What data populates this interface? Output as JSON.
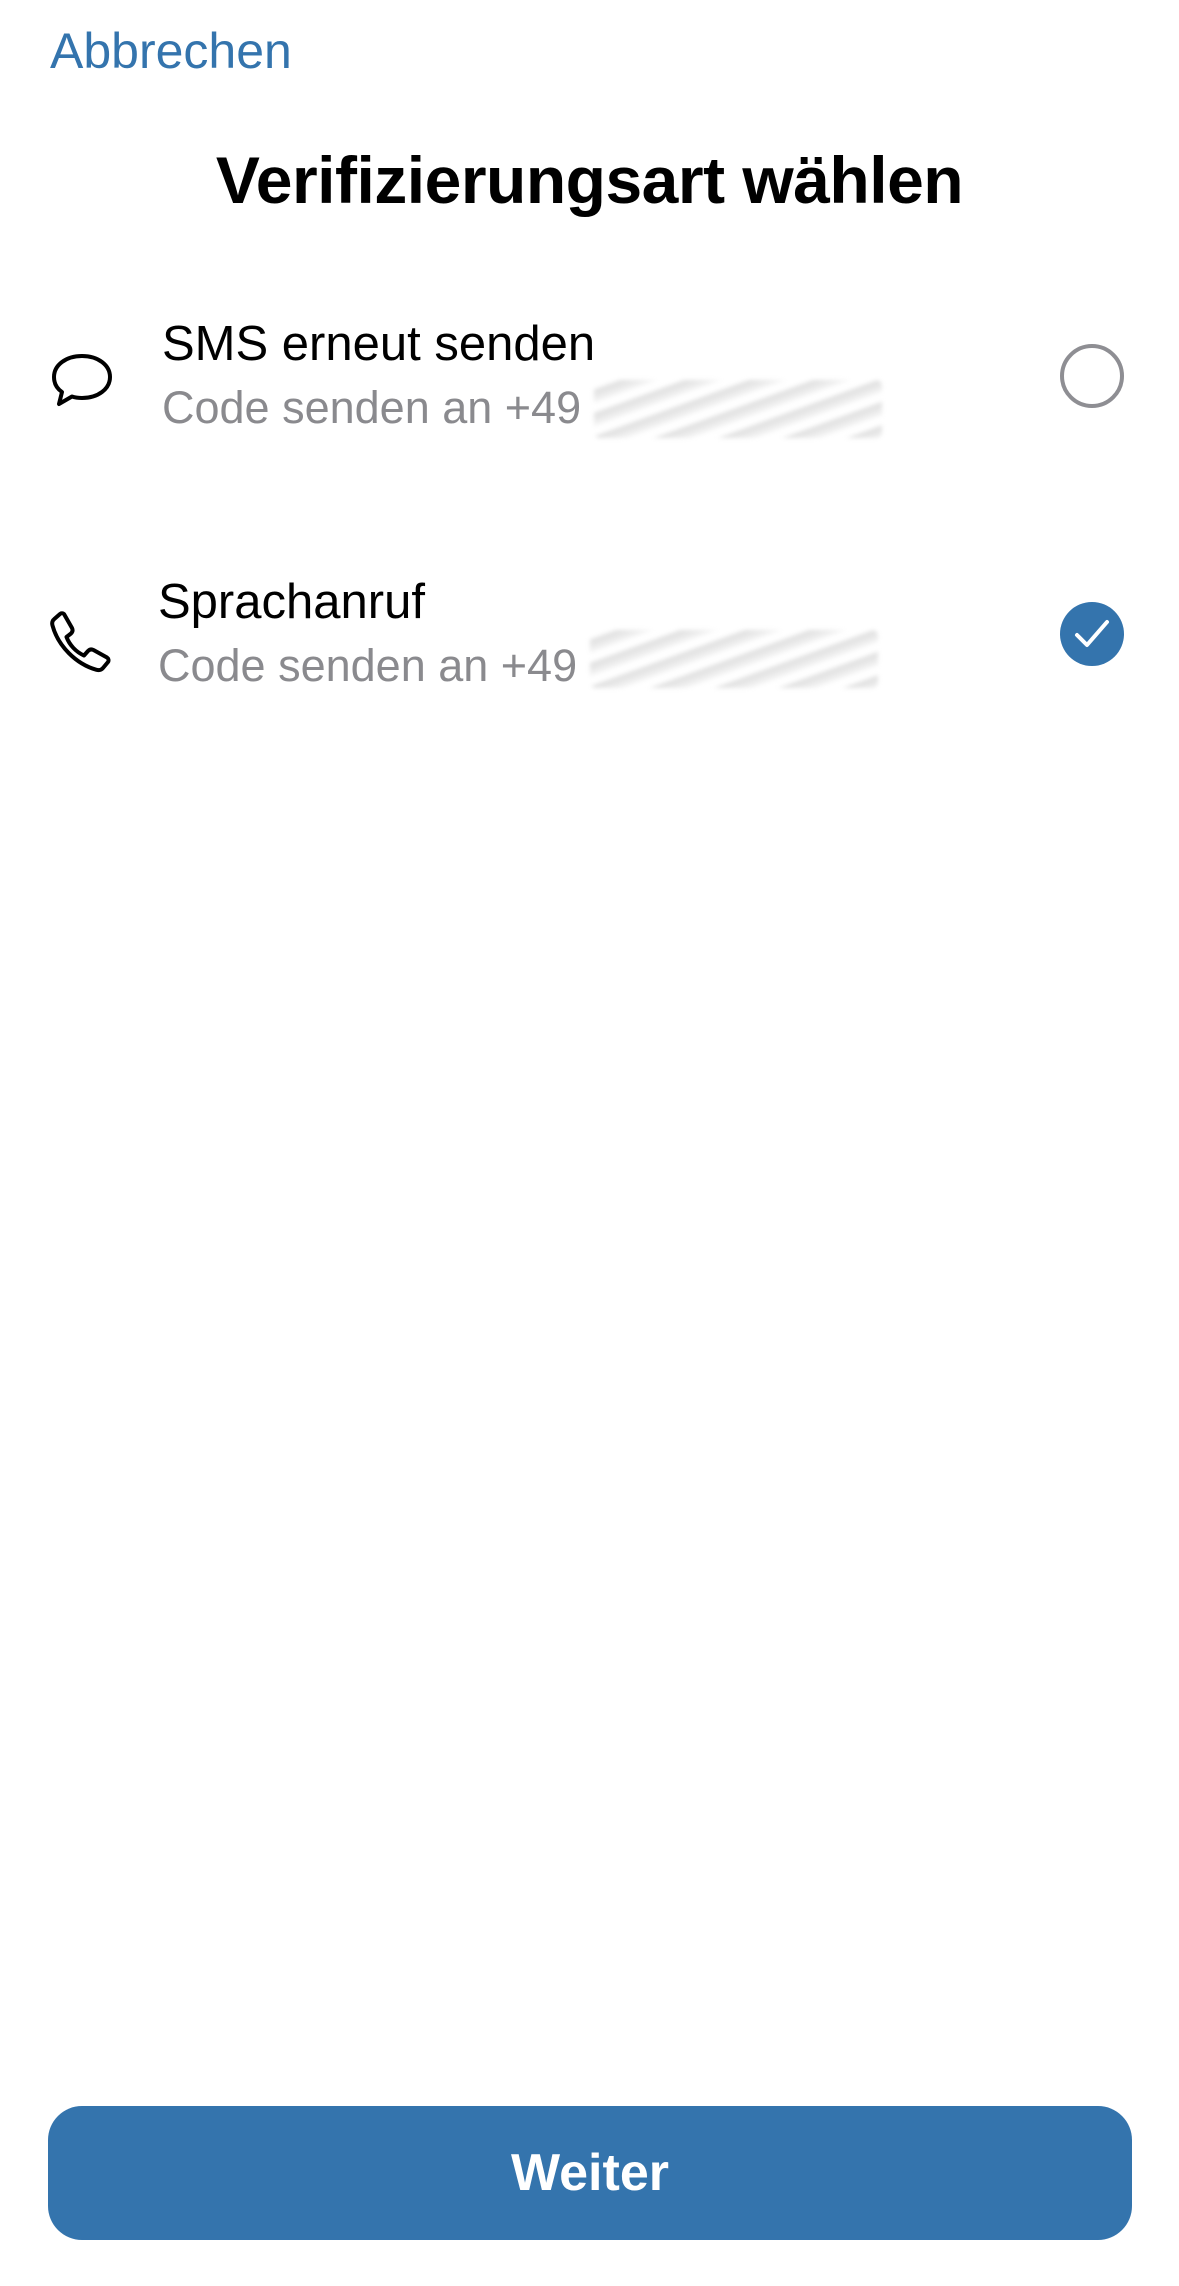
{
  "header": {
    "cancel_label": "Abbrechen",
    "title": "Verifizierungsart wählen"
  },
  "options": [
    {
      "icon": "chat-bubble-icon",
      "label": "SMS erneut senden",
      "subtitle": "Code senden an +49",
      "selected": false
    },
    {
      "icon": "phone-icon",
      "label": "Sprachanruf",
      "subtitle": "Code senden an +49",
      "selected": true
    }
  ],
  "footer": {
    "continue_label": "Weiter"
  },
  "colors": {
    "accent": "#3474ad",
    "secondary_text": "#8a8a8e",
    "radio_border": "#8e8e93"
  }
}
